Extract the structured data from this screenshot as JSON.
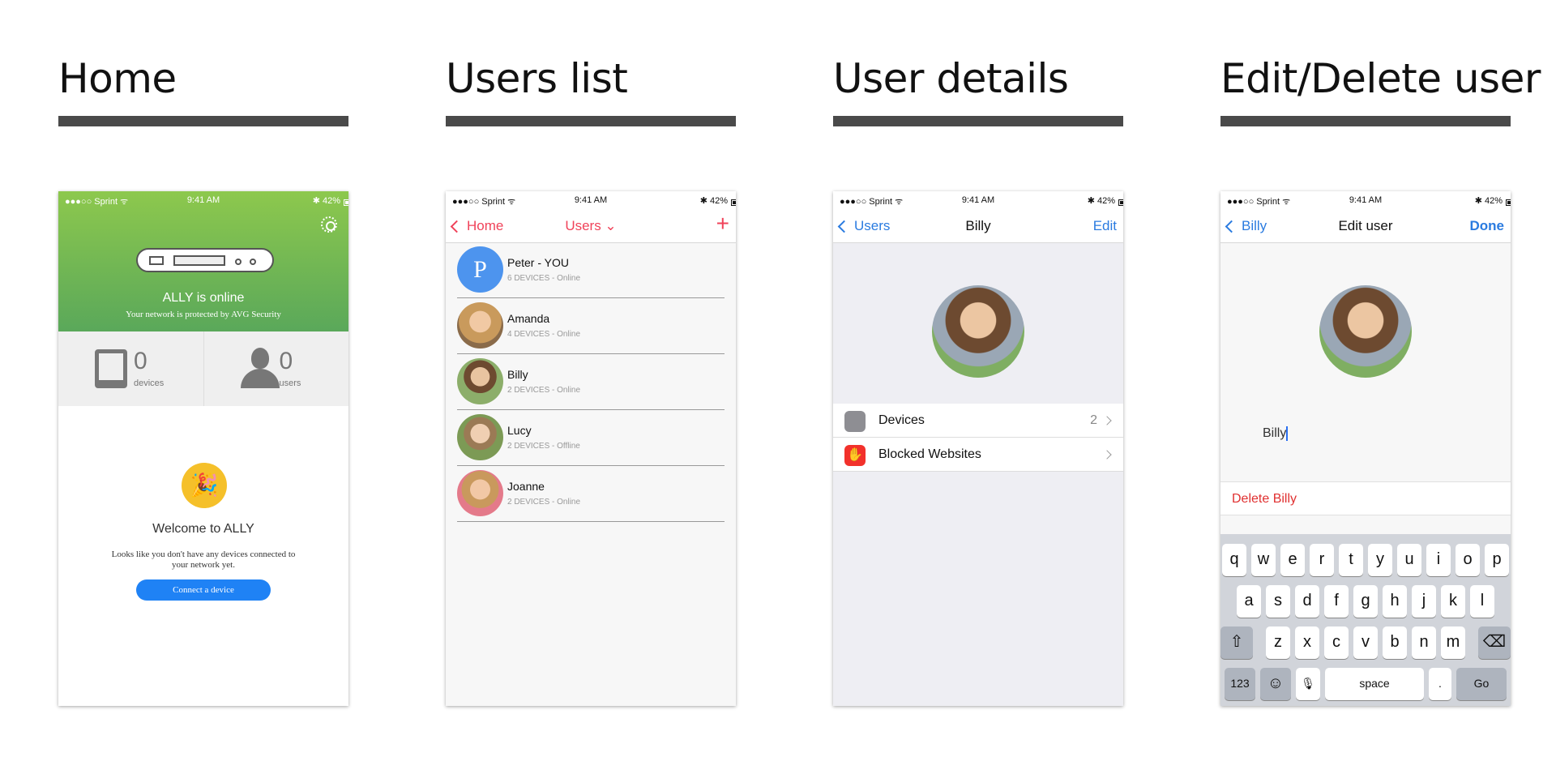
{
  "panels": [
    {
      "title": "Home"
    },
    {
      "title": "Users list"
    },
    {
      "title": "User details"
    },
    {
      "title": "Edit/Delete user"
    }
  ],
  "status": {
    "carrier": "●●●○○ Sprint ᯤ",
    "time": "9:41 AM",
    "battery": "✱ 42%"
  },
  "home": {
    "online_title": "ALLY is online",
    "protected_text": "Your network is protected by AVG Security",
    "devices_count": "0",
    "devices_label": "devices",
    "users_count": "0",
    "users_label": "users",
    "welcome_title": "Welcome to ALLY",
    "welcome_text": "Looks like you don't have any devices connected to your network yet.",
    "connect_button": "Connect a device",
    "colors": {
      "hero_top": "#8dc84d",
      "hero_bottom": "#5aa85a",
      "button": "#1f82f5"
    }
  },
  "users_list": {
    "back_label": "Home",
    "title": "Users ⌄",
    "add_label": "+",
    "accent": "#f0435a",
    "users": [
      {
        "name": "Peter - YOU",
        "sub": "6 DEVICES - Online",
        "initial": "P"
      },
      {
        "name": "Amanda",
        "sub": "4 DEVICES - Online"
      },
      {
        "name": "Billy",
        "sub": "2 DEVICES - Online"
      },
      {
        "name": "Lucy",
        "sub": "2 DEVICES - Offline"
      },
      {
        "name": "Joanne",
        "sub": "2 DEVICES - Online"
      }
    ]
  },
  "user_details": {
    "back_label": "Users",
    "title": "Billy",
    "edit_label": "Edit",
    "rows": [
      {
        "label": "Devices",
        "count": "2",
        "icon": "devices-icon"
      },
      {
        "label": "Blocked Websites",
        "count": "",
        "icon": "hand-stop-icon"
      }
    ]
  },
  "edit_user": {
    "back_label": "Billy",
    "title": "Edit user",
    "done_label": "Done",
    "name_value": "Billy",
    "delete_label": "Delete Billy",
    "keyboard": {
      "row1": [
        "q",
        "w",
        "e",
        "r",
        "t",
        "y",
        "u",
        "i",
        "o",
        "p"
      ],
      "row2": [
        "a",
        "s",
        "d",
        "f",
        "g",
        "h",
        "j",
        "k",
        "l"
      ],
      "row3": [
        "z",
        "x",
        "c",
        "v",
        "b",
        "n",
        "m"
      ],
      "shift": "⇧",
      "backspace": "⌫",
      "numbers": "123",
      "emoji": "☺",
      "mic": "🎙",
      "space": "space",
      "period": ".",
      "go": "Go"
    }
  }
}
